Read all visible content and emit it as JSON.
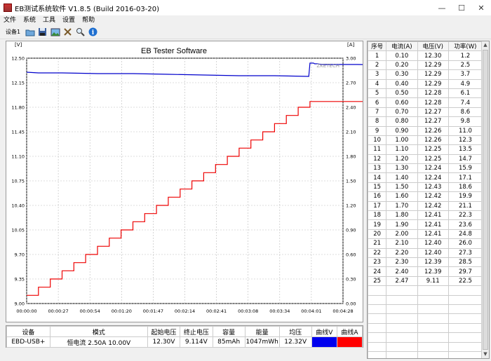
{
  "window": {
    "title": "EB测试系统软件 V1.8.5 (Build 2016-03-20)",
    "min": "—",
    "max": "☐",
    "close": "✕"
  },
  "menu": [
    "文件",
    "系统",
    "工具",
    "设置",
    "帮助"
  ],
  "toolbar": {
    "device": "设备1",
    "icons": [
      "open-folder-icon",
      "save-icon",
      "picture-icon",
      "tools-icon",
      "zoom-icon",
      "info-icon"
    ]
  },
  "chart_data": {
    "type": "line",
    "title": "EB Tester Software",
    "watermark": "ZKETECH",
    "left_unit": "[V]",
    "right_unit": "[A]",
    "left_ticks": [
      "12.50",
      "12.15",
      "11.80",
      "11.45",
      "11.10",
      "10.75",
      "10.40",
      "10.05",
      "9.70",
      "9.35",
      "9.00"
    ],
    "right_ticks": [
      "3.00",
      "2.70",
      "2.40",
      "2.10",
      "1.80",
      "1.50",
      "1.20",
      "0.90",
      "0.60",
      "0.30",
      "0.00"
    ],
    "x_ticks": [
      "00:00:00",
      "00:00:27",
      "00:00:54",
      "00:01:20",
      "00:01:47",
      "00:02:14",
      "00:02:41",
      "00:03:08",
      "00:03:34",
      "00:04:01",
      "00:04:28"
    ],
    "ylim_left": [
      9.0,
      12.5
    ],
    "ylim_right": [
      0.0,
      3.0
    ],
    "xlim_s": [
      0,
      268
    ],
    "grid": true,
    "series": [
      {
        "axis": "left",
        "color": "#0000cc",
        "x": [
          0,
          10,
          30,
          60,
          90,
          120,
          150,
          180,
          210,
          239,
          240,
          243,
          244,
          246,
          250,
          280,
          330,
          360,
          380,
          395,
          400,
          405,
          407,
          407.5
        ],
        "y": [
          12.3,
          12.29,
          12.29,
          12.28,
          12.28,
          12.27,
          12.26,
          12.25,
          12.25,
          12.24,
          12.43,
          12.43,
          12.42,
          12.42,
          12.41,
          12.41,
          12.4,
          12.4,
          12.39,
          12.39,
          12.39,
          12.39,
          12.38,
          9.11
        ]
      },
      {
        "axis": "right",
        "color": "#ee0000",
        "x": [
          0,
          10,
          10,
          20,
          20,
          30,
          30,
          40,
          40,
          50,
          50,
          60,
          60,
          70,
          70,
          80,
          80,
          90,
          90,
          100,
          100,
          110,
          110,
          120,
          120,
          130,
          130,
          140,
          140,
          150,
          150,
          160,
          160,
          170,
          170,
          180,
          180,
          190,
          190,
          200,
          200,
          210,
          210,
          220,
          220,
          230,
          230,
          240,
          240,
          250,
          250,
          260,
          260,
          270,
          270,
          280,
          280,
          290,
          290,
          300,
          300,
          310,
          310,
          320,
          320,
          330,
          330,
          340,
          340,
          350,
          350,
          360,
          360,
          370,
          370,
          380,
          380,
          390,
          390,
          400,
          400,
          407
        ],
        "y": [
          0.1,
          0.1,
          0.2,
          0.2,
          0.3,
          0.3,
          0.4,
          0.4,
          0.5,
          0.5,
          0.6,
          0.6,
          0.7,
          0.7,
          0.8,
          0.8,
          0.9,
          0.9,
          1.0,
          1.0,
          1.1,
          1.1,
          1.2,
          1.2,
          1.3,
          1.3,
          1.4,
          1.4,
          1.5,
          1.5,
          1.6,
          1.6,
          1.7,
          1.7,
          1.8,
          1.8,
          1.9,
          1.9,
          2.0,
          2.0,
          2.1,
          2.1,
          2.2,
          2.2,
          2.3,
          2.3,
          2.4,
          2.4,
          2.47,
          2.47,
          2.47,
          2.47,
          2.47,
          2.47,
          2.47,
          2.47,
          2.47,
          2.47,
          2.47,
          2.47,
          2.47,
          2.47,
          2.47,
          2.47,
          2.47,
          2.47,
          2.47,
          2.47,
          2.47,
          2.47,
          2.47,
          2.47,
          2.47,
          2.47,
          2.47,
          2.47,
          2.47,
          2.47,
          2.47,
          2.47,
          2.47,
          2.47
        ]
      }
    ]
  },
  "grid": {
    "headers": [
      "序号",
      "电流(A)",
      "电压(V)",
      "功率(W)"
    ],
    "rows": [
      [
        "1",
        "0.10",
        "12.30",
        "1.2"
      ],
      [
        "2",
        "0.20",
        "12.29",
        "2.5"
      ],
      [
        "3",
        "0.30",
        "12.29",
        "3.7"
      ],
      [
        "4",
        "0.40",
        "12.29",
        "4.9"
      ],
      [
        "5",
        "0.50",
        "12.28",
        "6.1"
      ],
      [
        "6",
        "0.60",
        "12.28",
        "7.4"
      ],
      [
        "7",
        "0.70",
        "12.27",
        "8.6"
      ],
      [
        "8",
        "0.80",
        "12.27",
        "9.8"
      ],
      [
        "9",
        "0.90",
        "12.26",
        "11.0"
      ],
      [
        "10",
        "1.00",
        "12.26",
        "12.3"
      ],
      [
        "11",
        "1.10",
        "12.25",
        "13.5"
      ],
      [
        "12",
        "1.20",
        "12.25",
        "14.7"
      ],
      [
        "13",
        "1.30",
        "12.24",
        "15.9"
      ],
      [
        "14",
        "1.40",
        "12.24",
        "17.1"
      ],
      [
        "15",
        "1.50",
        "12.43",
        "18.6"
      ],
      [
        "16",
        "1.60",
        "12.42",
        "19.9"
      ],
      [
        "17",
        "1.70",
        "12.42",
        "21.1"
      ],
      [
        "18",
        "1.80",
        "12.41",
        "22.3"
      ],
      [
        "19",
        "1.90",
        "12.41",
        "23.6"
      ],
      [
        "20",
        "2.00",
        "12.41",
        "24.8"
      ],
      [
        "21",
        "2.10",
        "12.40",
        "26.0"
      ],
      [
        "22",
        "2.20",
        "12.40",
        "27.3"
      ],
      [
        "23",
        "2.30",
        "12.39",
        "28.5"
      ],
      [
        "24",
        "2.40",
        "12.39",
        "29.7"
      ],
      [
        "25",
        "2.47",
        "9.11",
        "22.5"
      ]
    ],
    "empty_rows": 8
  },
  "summary": {
    "headers": [
      "设备",
      "模式",
      "起始电压",
      "终止电压",
      "容量",
      "能量",
      "均压",
      "曲线V",
      "曲线A"
    ],
    "values": [
      "EBD-USB+",
      "恒电流  2.50A  10.00V",
      "12.30V",
      "9.114V",
      "85mAh",
      "1047mWh",
      "12.32V",
      "",
      ""
    ],
    "curve_v_color": "#0000ee",
    "curve_a_color": "#ff0000"
  }
}
